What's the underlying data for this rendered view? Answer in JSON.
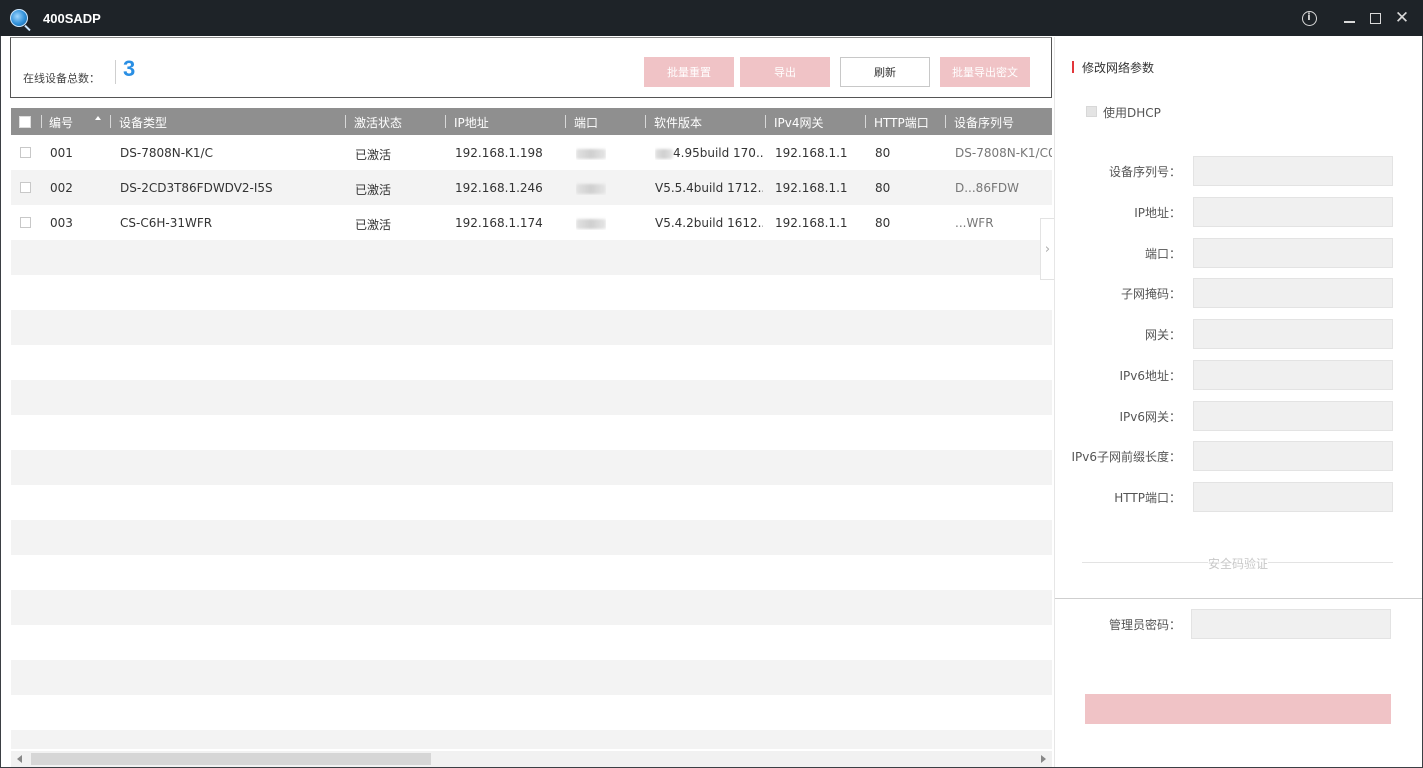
{
  "app": {
    "title": "400SADP"
  },
  "header": {
    "online_label": "在线设备总数：",
    "online_count": "3",
    "buttons": {
      "batch_reset": "批量重置",
      "export": "导出",
      "refresh": "刷新",
      "batch_export_cipher": "批量导出密文"
    }
  },
  "table": {
    "columns": [
      "编号",
      "设备类型",
      "激活状态",
      "IP地址",
      "端口",
      "软件版本",
      "IPv4网关",
      "HTTP端口",
      "设备序列号"
    ],
    "rows": [
      {
        "id": "001",
        "type": "DS-7808N-K1/C",
        "status": "已激活",
        "ip": "192.168.1.198",
        "version": "4.95build 170...",
        "gateway": "192.168.1.1",
        "http_port": "80",
        "serial": "DS-7808N-K1/C0"
      },
      {
        "id": "002",
        "type": "DS-2CD3T86FDWDV2-I5S",
        "status": "已激活",
        "ip": "192.168.1.246",
        "version": "V5.5.4build 1712...",
        "gateway": "192.168.1.1",
        "http_port": "80",
        "serial": "D...86FDW"
      },
      {
        "id": "003",
        "type": "CS-C6H-31WFR",
        "status": "已激活",
        "ip": "192.168.1.174",
        "version": "V5.4.2build 1612...",
        "gateway": "192.168.1.1",
        "http_port": "80",
        "serial": "...WFR"
      }
    ]
  },
  "panel": {
    "title": "修改网络参数",
    "dhcp_label": "使用DHCP",
    "fields": [
      "设备序列号：",
      "IP地址：",
      "端口：",
      "子网掩码：",
      "网关：",
      "IPv6地址：",
      "IPv6网关：",
      "IPv6子网前缀长度：",
      "HTTP端口："
    ],
    "verify_text": "安全码验证",
    "password_label": "管理员密码："
  },
  "colors": {
    "accent_blue": "#2a8fe4",
    "accent_red": "#e2363b",
    "disabled_pink": "#f0c3c6",
    "titlebar": "#1e2328"
  },
  "icons": [
    "app-logo-icon",
    "info-icon",
    "minimize-icon",
    "maximize-icon",
    "close-icon",
    "sort-up-icon",
    "chevron-right-icon"
  ]
}
